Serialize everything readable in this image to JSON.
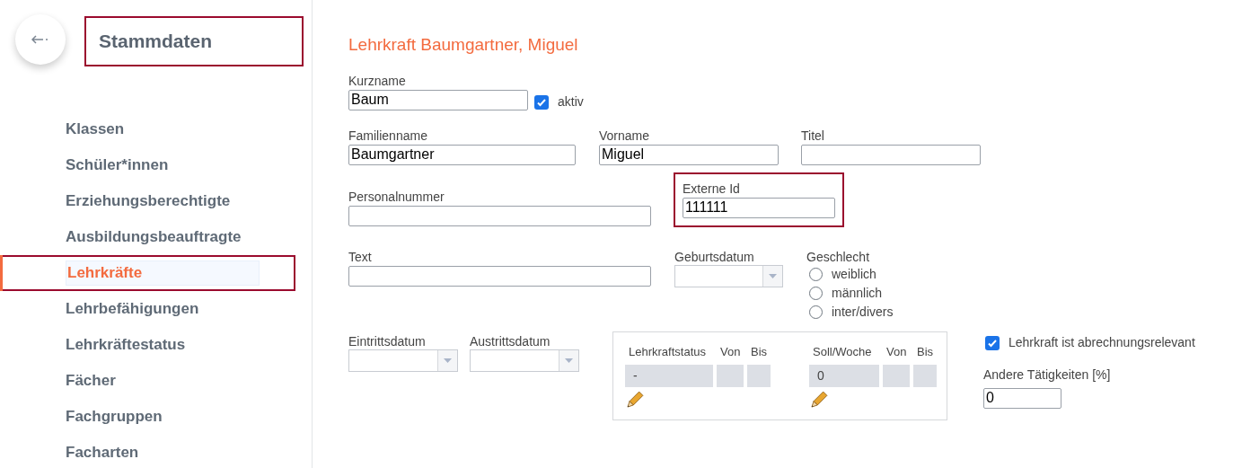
{
  "sidebar": {
    "title": "Stammdaten",
    "title_highlighted": true,
    "items": [
      {
        "label": "Klassen",
        "selected": false,
        "highlighted": false
      },
      {
        "label": "Schüler*innen",
        "selected": false,
        "highlighted": false
      },
      {
        "label": "Erziehungsberechtigte",
        "selected": false,
        "highlighted": false
      },
      {
        "label": "Ausbildungsbeauftragte",
        "selected": false,
        "highlighted": false
      },
      {
        "label": "Lehrkräfte",
        "selected": true,
        "highlighted": true
      },
      {
        "label": "Lehrbefähigungen",
        "selected": false,
        "highlighted": false
      },
      {
        "label": "Lehrkräftestatus",
        "selected": false,
        "highlighted": false
      },
      {
        "label": "Fächer",
        "selected": false,
        "highlighted": false
      },
      {
        "label": "Fachgruppen",
        "selected": false,
        "highlighted": false
      },
      {
        "label": "Facharten",
        "selected": false,
        "highlighted": false
      }
    ]
  },
  "form": {
    "title": "Lehrkraft Baumgartner, Miguel",
    "kurzname": {
      "label": "Kurzname",
      "value": "Baum"
    },
    "aktiv": {
      "label": "aktiv",
      "checked": true
    },
    "familienname": {
      "label": "Familienname",
      "value": "Baumgartner"
    },
    "vorname": {
      "label": "Vorname",
      "value": "Miguel"
    },
    "titel": {
      "label": "Titel"
    },
    "personalnummer": {
      "label": "Personalnummer"
    },
    "externe_id": {
      "label": "Externe Id",
      "value": "111111",
      "highlighted": true
    },
    "text": {
      "label": "Text"
    },
    "geburtsdatum": {
      "label": "Geburtsdatum",
      "disabled": true
    },
    "geschlecht": {
      "label": "Geschlecht",
      "options": [
        {
          "label": "weiblich",
          "selected": false
        },
        {
          "label": "männlich",
          "selected": false
        },
        {
          "label": "inter/divers",
          "selected": false
        }
      ]
    },
    "eintrittsdatum": {
      "label": "Eintrittsdatum",
      "disabled": true
    },
    "austrittsdatum": {
      "label": "Austrittsdatum",
      "disabled": true
    },
    "status_tables": [
      {
        "columns": [
          "Lehrkraftstatus",
          "Von",
          "Bis"
        ],
        "cells": [
          "-",
          "",
          ""
        ]
      },
      {
        "columns": [
          "Soll/Woche",
          "Von",
          "Bis"
        ],
        "cells": [
          "0",
          "",
          ""
        ]
      }
    ],
    "abrechnungsrelevant": {
      "label": "Lehrkraft ist abrechnungsrelevant",
      "checked": true
    },
    "andere_taetigkeiten": {
      "label": "Andere Tätigkeiten [%]",
      "value": "0"
    }
  }
}
